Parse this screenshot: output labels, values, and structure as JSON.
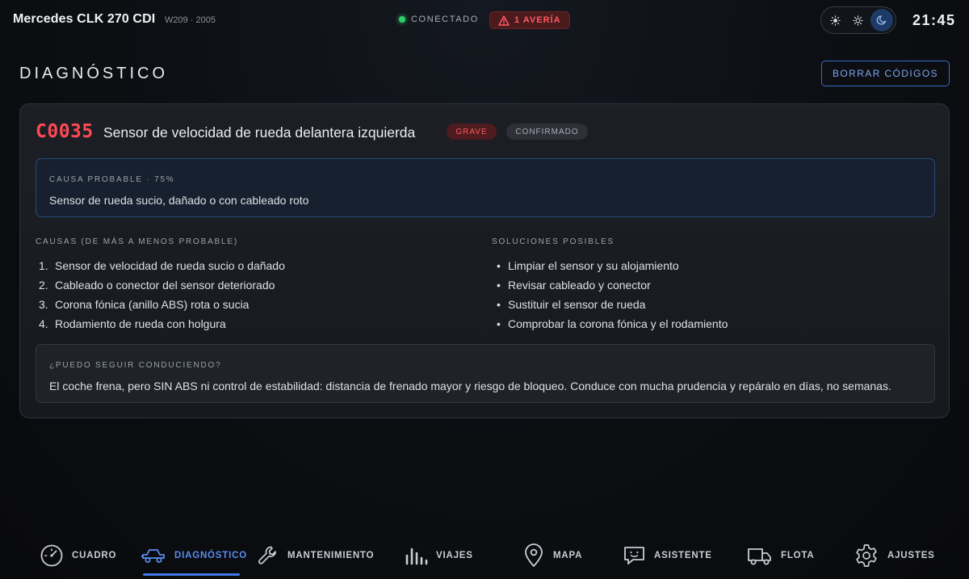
{
  "topbar": {
    "car_name": "Mercedes CLK 270 CDI",
    "car_sub": "W209 · 2005",
    "status": "CONECTADO",
    "fault_badge": "1 AVERÍA",
    "clock": "21:45",
    "theme_options": [
      "sun-auto-icon",
      "sun-icon",
      "moon-icon"
    ],
    "theme_active": "moon-icon"
  },
  "header": {
    "title": "DIAGNÓSTICO",
    "clear_button": "BORRAR CÓDIGOS"
  },
  "dtc": {
    "code": "C0035",
    "title": "Sensor de velocidad de rueda delantera izquierda",
    "severity": "GRAVE",
    "state": "CONFIRMADO",
    "probable_cause_label": "CAUSA PROBABLE · 75%",
    "probable_cause": "Sensor de rueda sucio, dañado o con cableado roto",
    "causes_label": "CAUSAS (DE MÁS A MENOS PROBABLE)",
    "causes": [
      "Sensor de velocidad de rueda sucio o dañado",
      "Cableado o conector del sensor deteriorado",
      "Corona fónica (anillo ABS) rota o sucia",
      "Rodamiento de rueda con holgura"
    ],
    "solutions_label": "SOLUCIONES POSIBLES",
    "solutions": [
      "Limpiar el sensor y su alojamiento",
      "Revisar cableado y conector",
      "Sustituir el sensor de rueda",
      "Comprobar la corona fónica y el rodamiento"
    ],
    "drive_label": "¿PUEDO SEGUIR CONDUCIENDO?",
    "drive_text": "El coche frena, pero SIN ABS ni control de estabilidad: distancia de frenado mayor y riesgo de bloqueo. Conduce con mucha prudencia y repáralo en días, no semanas."
  },
  "nav": {
    "items": [
      {
        "label": "CUADRO",
        "icon": "gauge-icon"
      },
      {
        "label": "DIAGNÓSTICO",
        "icon": "car-icon"
      },
      {
        "label": "MANTENIMIENTO",
        "icon": "wrench-icon"
      },
      {
        "label": "VIAJES",
        "icon": "bar-chart-icon"
      },
      {
        "label": "MAPA",
        "icon": "map-pin-icon"
      },
      {
        "label": "ASISTENTE",
        "icon": "chat-bot-icon"
      },
      {
        "label": "FLOTA",
        "icon": "truck-icon"
      },
      {
        "label": "AJUSTES",
        "icon": "gear-icon"
      }
    ],
    "active": "DIAGNÓSTICO"
  },
  "colors": {
    "accent": "#3f7ae8",
    "danger": "#ff4a55",
    "ok": "#2fd06a"
  }
}
